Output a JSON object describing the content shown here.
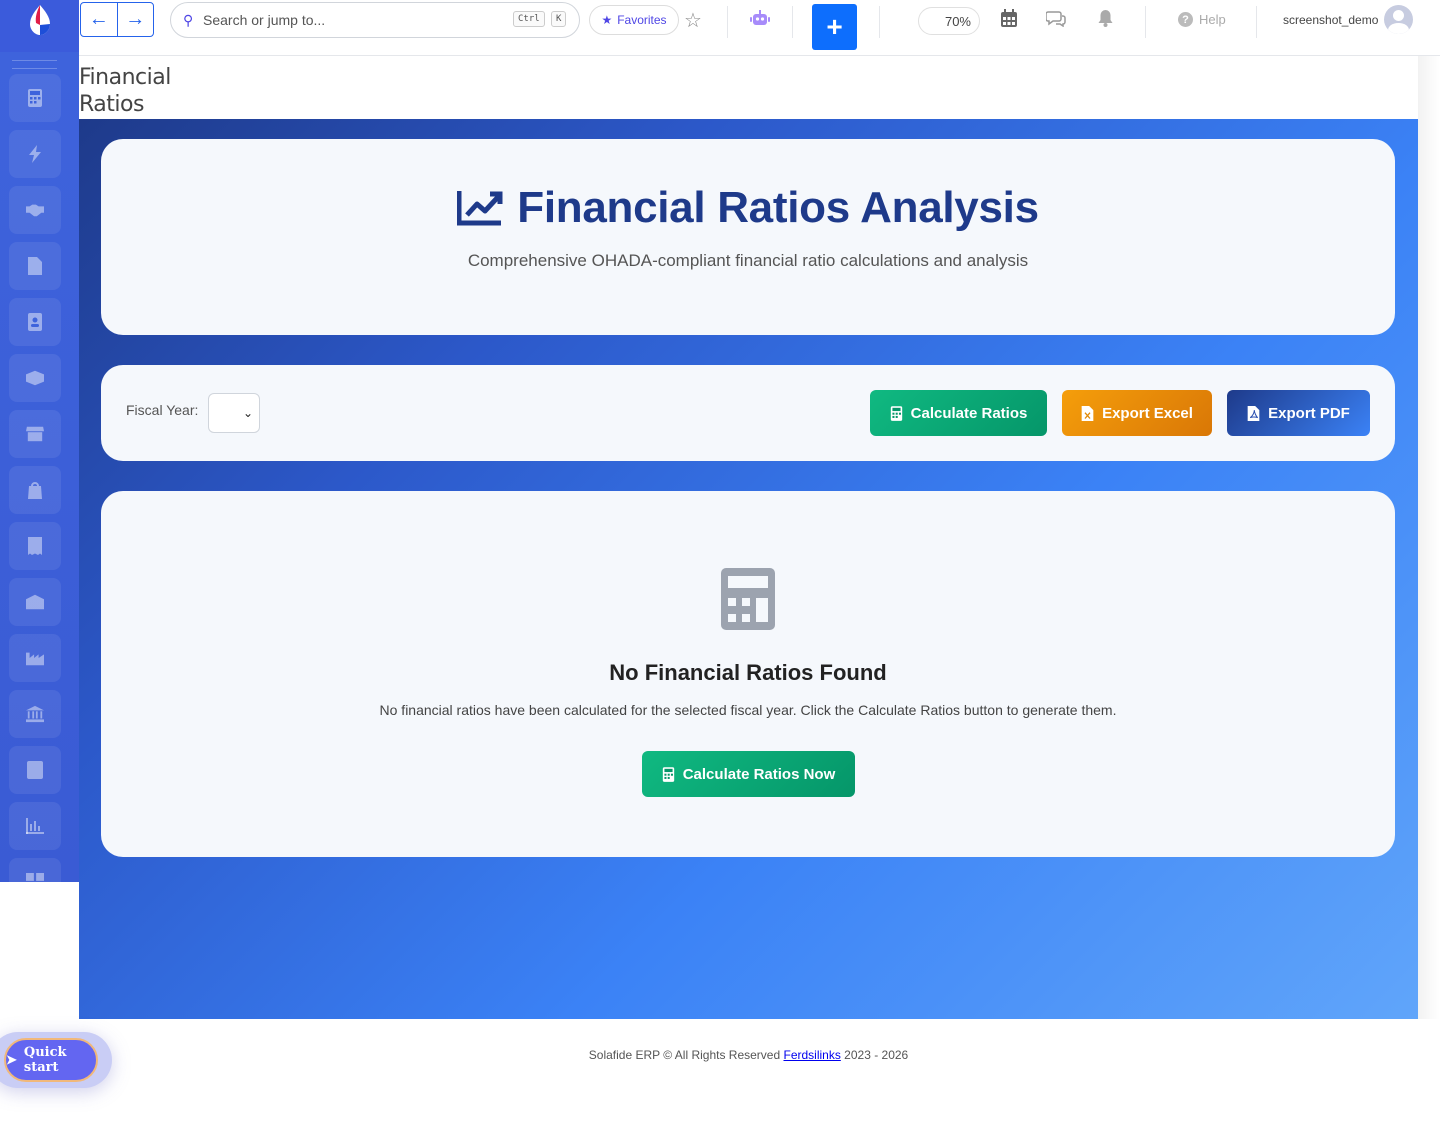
{
  "topbar": {
    "search_placeholder": "Search or jump to...",
    "kbd_ctrl": "Ctrl",
    "kbd_k": "K",
    "favorites_label": "Favorites",
    "plus_label": "+",
    "zoom": "70%",
    "help_label": "Help",
    "username": "screenshot_demo"
  },
  "page": {
    "title_line1": "Financial",
    "title_line2": "Ratios"
  },
  "hero": {
    "title": "Financial Ratios Analysis",
    "subtitle": "Comprehensive OHADA-compliant financial ratio calculations and analysis"
  },
  "controls": {
    "fiscal_year_label": "Fiscal Year:",
    "fiscal_year_value": "",
    "calculate_label": "Calculate Ratios",
    "export_excel_label": "Export Excel",
    "export_pdf_label": "Export PDF"
  },
  "empty_state": {
    "title": "No Financial Ratios Found",
    "message": "No financial ratios have been calculated for the selected fiscal year. Click the Calculate Ratios button to generate them.",
    "button_label": "Calculate Ratios Now"
  },
  "footer": {
    "prefix": "Solafide ERP © All Rights Reserved ",
    "link": "Ferdsilinks",
    "suffix": " 2023 - 2026"
  },
  "quick_start": {
    "label": "Quick start"
  },
  "colors": {
    "accent_blue": "#0d6efd",
    "title_navy": "#1e3a8a",
    "success_green": "#10b981",
    "warning_orange": "#f59e0b"
  }
}
